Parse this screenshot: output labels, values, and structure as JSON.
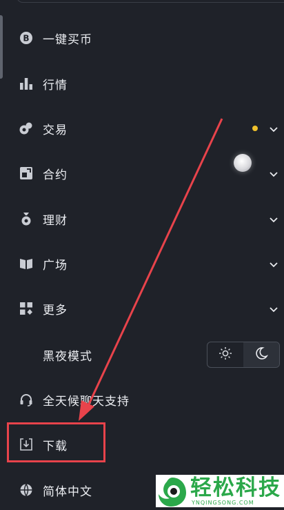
{
  "menu": {
    "items": [
      {
        "id": "buy-crypto",
        "label": "一键买币",
        "icon": "bitcoin-icon",
        "has_chevron": false
      },
      {
        "id": "market",
        "label": "行情",
        "icon": "bar-chart-icon",
        "has_chevron": false
      },
      {
        "id": "trade",
        "label": "交易",
        "icon": "trade-icon",
        "has_chevron": true,
        "has_dot": true
      },
      {
        "id": "contract",
        "label": "合约",
        "icon": "contract-icon",
        "has_chevron": true
      },
      {
        "id": "finance",
        "label": "理财",
        "icon": "money-bag-icon",
        "has_chevron": true
      },
      {
        "id": "square",
        "label": "广场",
        "icon": "book-icon",
        "has_chevron": true
      },
      {
        "id": "more",
        "label": "更多",
        "icon": "grid-icon",
        "has_chevron": true
      },
      {
        "id": "dark-mode",
        "label": "黑夜模式"
      },
      {
        "id": "support",
        "label": "全天候聊天支持",
        "icon": "headset-icon"
      },
      {
        "id": "download",
        "label": "下载",
        "icon": "download-icon"
      },
      {
        "id": "language",
        "label": "简体中文",
        "icon": "globe-icon"
      }
    ]
  },
  "theme": {
    "options": [
      "sun-icon",
      "moon-icon"
    ],
    "active": "moon-icon"
  },
  "colors": {
    "background": "#1f2229",
    "accent_dot": "#f0c12c",
    "annotation": "#e8434b",
    "watermark": "#2ba84a"
  },
  "watermark": {
    "title": "轻松科技",
    "subtitle": "YNQINGSONG.COM"
  }
}
